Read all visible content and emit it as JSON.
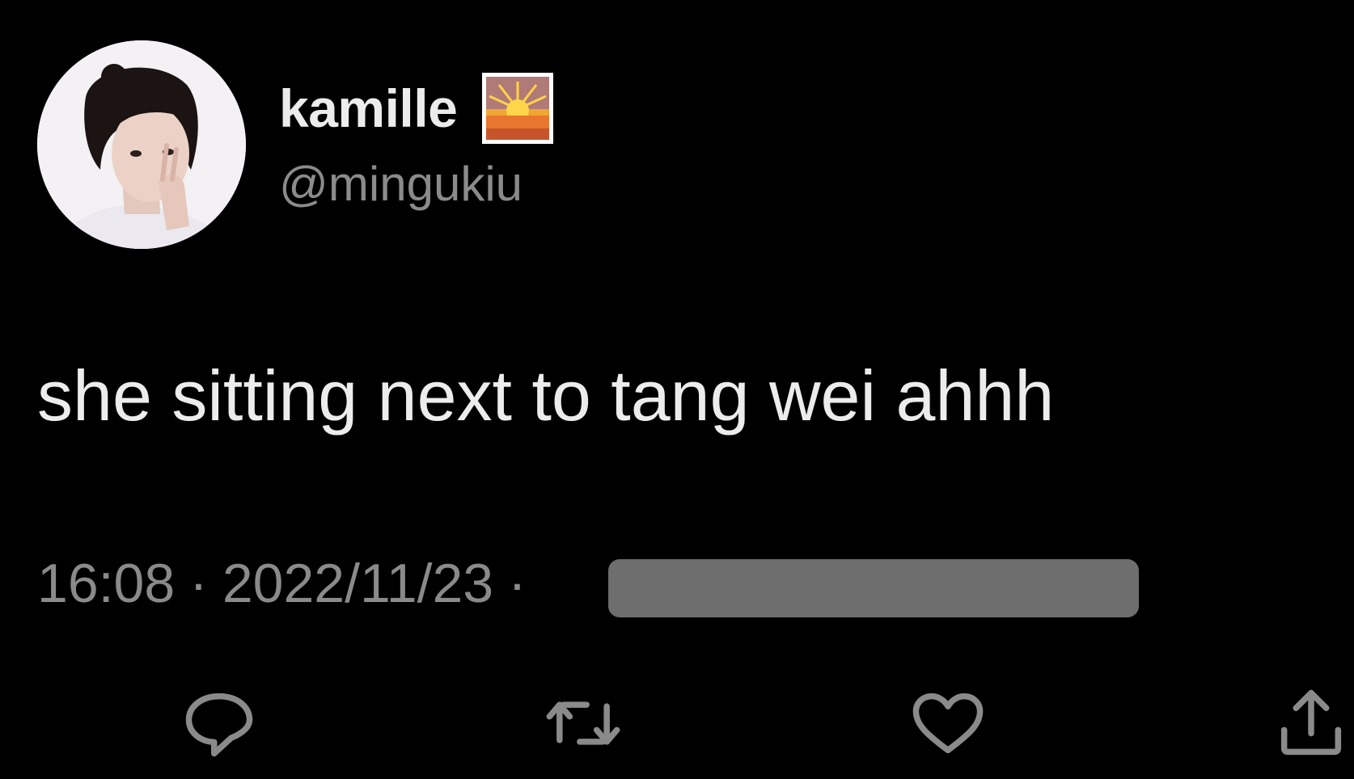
{
  "tweet": {
    "display_name": "kamille",
    "name_emoji": "sunrise-emoji",
    "handle": "@mingukiu",
    "text": "she sitting next to tang wei ahhh",
    "time": "16:08",
    "separator": "·",
    "date": "2022/11/23",
    "source_redacted": true
  },
  "actions": [
    {
      "name": "reply",
      "icon": "reply-icon"
    },
    {
      "name": "retweet",
      "icon": "retweet-icon"
    },
    {
      "name": "like",
      "icon": "heart-icon"
    },
    {
      "name": "share",
      "icon": "share-icon"
    }
  ],
  "colors": {
    "background": "#000000",
    "primary_text": "#ececec",
    "secondary_text": "#8a8a8a",
    "icon": "#8a8a8a",
    "redaction": "#6e6e6e"
  }
}
